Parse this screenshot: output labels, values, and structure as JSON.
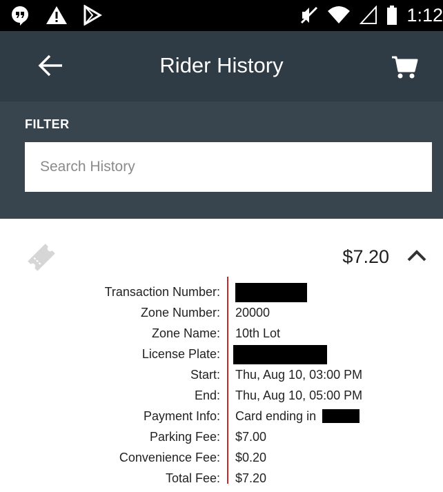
{
  "status_bar": {
    "time": "1:12",
    "left_icons": [
      "hangouts-icon",
      "warning-icon",
      "play-store-icon"
    ],
    "right_icons": [
      "mute-icon",
      "wifi-icon",
      "signal-icon",
      "battery-icon"
    ]
  },
  "app_bar": {
    "title": "Rider History",
    "back_icon": "arrow-left-icon",
    "cart_icon": "shopping-cart-icon",
    "background": "#2f3b45"
  },
  "filter": {
    "label": "FILTER",
    "search_placeholder": "Search History",
    "search_value": "",
    "background": "#38444e"
  },
  "history_item": {
    "amount": "$7.20",
    "expanded": true,
    "details": [
      {
        "label": "Transaction Number:",
        "value": "",
        "redacted": true
      },
      {
        "label": "Zone Number:",
        "value": "20000"
      },
      {
        "label": "Zone Name:",
        "value": "10th Lot"
      },
      {
        "label": "License Plate:",
        "value": "",
        "redacted": true
      },
      {
        "label": "Start:",
        "value": "Thu, Aug 10, 03:00 PM"
      },
      {
        "label": "End:",
        "value": "Thu, Aug 10, 05:00 PM"
      },
      {
        "label": "Payment Info:",
        "value": "Card ending in",
        "redacted_suffix": true
      },
      {
        "label": "Parking Fee:",
        "value": "$7.00"
      },
      {
        "label": "Convenience Fee:",
        "value": "$0.20"
      },
      {
        "label": "Total Fee:",
        "value": "$7.20"
      }
    ],
    "divider_color": "#c62828"
  }
}
